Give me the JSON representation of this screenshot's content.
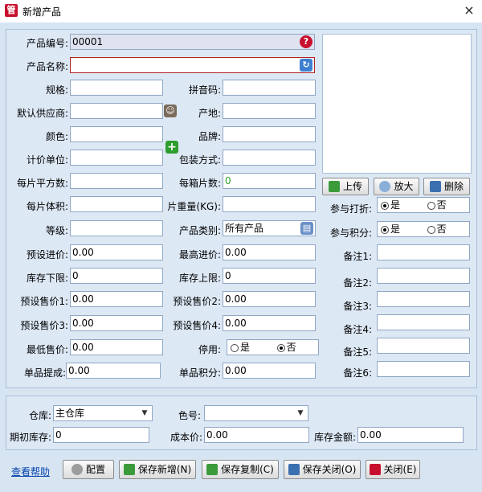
{
  "window": {
    "title": "新增产品",
    "icon": "app-logo-icon",
    "close": "×"
  },
  "form": {
    "code_label": "产品编号:",
    "code_value": "00001",
    "name_label": "产品名称:",
    "name_value": "",
    "spec_label": "规格:",
    "pinyin_label": "拼音码:",
    "supplier_label": "默认供应商:",
    "origin_label": "产地:",
    "color_label": "颜色:",
    "brand_label": "品牌:",
    "unit_label": "计价单位:",
    "pack_label": "包装方式:",
    "sqm_label": "每片平方数:",
    "pcs_label": "每箱片数:",
    "pcs_value": "0",
    "vol_label": "每片体积:",
    "weight_label": "片重量(KG):",
    "grade_label": "等级:",
    "category_label": "产品类别:",
    "category_value": "所有产品",
    "buy_price_label": "预设进价:",
    "buy_price_value": "0.00",
    "max_price_label": "最高进价:",
    "max_price_value": "0.00",
    "stock_low_label": "库存下限:",
    "stock_low_value": "0",
    "stock_high_label": "库存上限:",
    "stock_high_value": "0",
    "sale1_label": "预设售价1:",
    "sale1_value": "0.00",
    "sale2_label": "预设售价2:",
    "sale2_value": "0.00",
    "sale3_label": "预设售价3:",
    "sale3_value": "0.00",
    "sale4_label": "预设售价4:",
    "sale4_value": "0.00",
    "min_sale_label": "最低售价:",
    "min_sale_value": "0.00",
    "disable_label": "停用:",
    "yes": "是",
    "no": "否",
    "commission_label": "单品提成:",
    "commission_value": "0.00",
    "points_label": "单品积分:",
    "points_value": "0.00"
  },
  "side": {
    "upload": "上传",
    "zoom": "放大",
    "delete": "删除",
    "discount_label": "参与打折:",
    "points_label": "参与积分:",
    "yes": "是",
    "no": "否",
    "notes": [
      "备注1:",
      "备注2:",
      "备注3:",
      "备注4:",
      "备注5:",
      "备注6:"
    ]
  },
  "bottom": {
    "warehouse_label": "仓库:",
    "warehouse_value": "主仓库",
    "color_no_label": "色号:",
    "color_no_value": "",
    "init_stock_label": "期初库存:",
    "init_stock_value": "0",
    "cost_label": "成本价:",
    "cost_value": "0.00",
    "stock_amount_label": "库存金额:",
    "stock_amount_value": "0.00"
  },
  "footer": {
    "help": "查看帮助",
    "config": "配置",
    "save_new": "保存新增(N)",
    "save_copy": "保存复制(C)",
    "save_close": "保存关闭(O)",
    "close": "关闭(E)"
  },
  "colors": {
    "accent_red": "#c8102e",
    "panel": "#dde8f5",
    "frame": "#d7e4f2",
    "add_green": "#2e9e2e"
  }
}
